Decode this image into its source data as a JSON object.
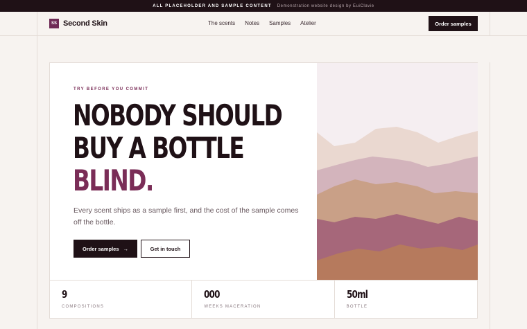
{
  "topbar": {
    "notice": "ALL PLACEHOLDER AND SAMPLE CONTENT",
    "credit": "Demonstration website design by EuiClavie"
  },
  "brand": {
    "logo_text": "SS",
    "name": "Second Skin"
  },
  "nav": {
    "items": [
      "The scents",
      "Notes",
      "Samples",
      "Atelier"
    ]
  },
  "header": {
    "order_label": "Order samples"
  },
  "hero": {
    "eyebrow": "TRY BEFORE YOU COMMIT",
    "headline_line1": "NOBODY SHOULD",
    "headline_line2": "BUY A BOTTLE",
    "headline_accent": "BLIND.",
    "subtext": "Every scent ships as a sample first, and the cost of the sample comes off the bottle.",
    "primary_label": "Order samples",
    "primary_arrow": "→",
    "secondary_label": "Get in touch"
  },
  "stats": [
    {
      "value": "9",
      "label": "COMPOSITIONS"
    },
    {
      "value": "000",
      "label": "WEEKS MACERATION"
    },
    {
      "value": "50ml",
      "label": "BOTTLE"
    }
  ],
  "colors": {
    "accent": "#7a2d57",
    "dark": "#1f1116",
    "background": "#f7f3f0"
  }
}
